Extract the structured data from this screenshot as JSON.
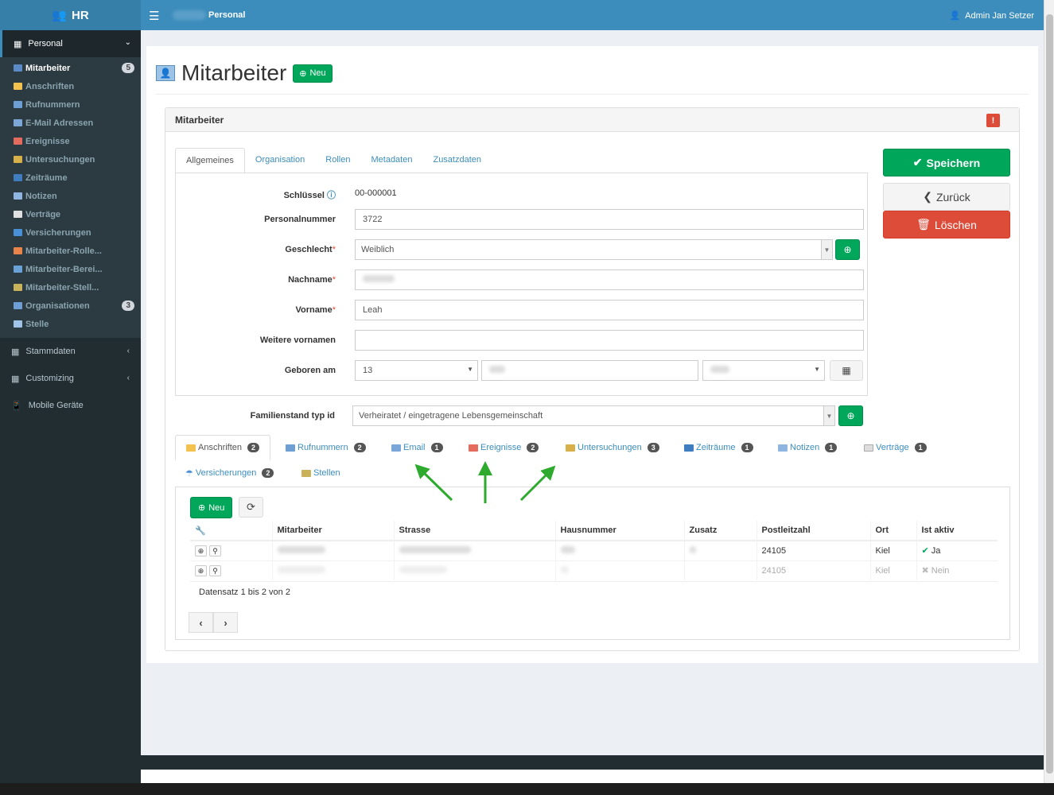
{
  "app": {
    "title": "HR",
    "breadcrumb": "Personal",
    "user": "Admin Jan Setzer"
  },
  "sidebar": {
    "section": "Personal",
    "items": [
      {
        "label": "Mitarbeiter",
        "count": "5",
        "color": "#5b8bc7"
      },
      {
        "label": "Anschriften",
        "color": "#f2c14e"
      },
      {
        "label": "Rufnummern",
        "color": "#6e9fd4"
      },
      {
        "label": "E-Mail Adressen",
        "color": "#7aa6d8"
      },
      {
        "label": "Ereignisse",
        "color": "#e46b5e"
      },
      {
        "label": "Untersuchungen",
        "color": "#d8b04a"
      },
      {
        "label": "Zeiträume",
        "color": "#3f7dc1"
      },
      {
        "label": "Notizen",
        "color": "#8fb6e0"
      },
      {
        "label": "Verträge",
        "color": "#e0e0e0"
      },
      {
        "label": "Versicherungen",
        "color": "#4a90d9"
      },
      {
        "label": "Mitarbeiter-Rolle...",
        "color": "#e8834a"
      },
      {
        "label": "Mitarbeiter-Berei...",
        "color": "#6aa2d8"
      },
      {
        "label": "Mitarbeiter-Stell...",
        "color": "#c9b25a"
      },
      {
        "label": "Organisationen",
        "count": "3",
        "color": "#6e9fd4"
      },
      {
        "label": "Stelle",
        "color": "#9fc4e8"
      }
    ],
    "stammdaten": "Stammdaten",
    "customizing": "Customizing",
    "mobile": "Mobile Geräte"
  },
  "page": {
    "title": "Mitarbeiter",
    "new_button": "Neu"
  },
  "panel": {
    "title": "Mitarbeiter"
  },
  "tabs": [
    "Allgemeines",
    "Organisation",
    "Rollen",
    "Metadaten",
    "Zusatzdaten"
  ],
  "form": {
    "key_label": "Schlüssel",
    "key_value": "00-000001",
    "personalnummer_label": "Personalnummer",
    "personalnummer_value": "3722",
    "geschlecht_label": "Geschlecht",
    "geschlecht_value": "Weiblich",
    "nachname_label": "Nachname",
    "vorname_label": "Vorname",
    "vorname_value": "Leah",
    "weitere_label": "Weitere vornamen",
    "geboren_label": "Geboren am",
    "geboren_day": "13",
    "familienstand_label": "Familienstand typ id",
    "familienstand_value": "Verheiratet / eingetragene Lebensgemeinschaft"
  },
  "actions": {
    "save": "Speichern",
    "back": "Zurück",
    "delete": "Löschen"
  },
  "subtabs": [
    {
      "label": "Anschriften",
      "count": "2"
    },
    {
      "label": "Rufnummern",
      "count": "2"
    },
    {
      "label": "Email",
      "count": "1"
    },
    {
      "label": "Ereignisse",
      "count": "2"
    },
    {
      "label": "Untersuchungen",
      "count": "3"
    },
    {
      "label": "Zeiträume",
      "count": "1"
    },
    {
      "label": "Notizen",
      "count": "1"
    },
    {
      "label": "Verträge",
      "count": "1"
    },
    {
      "label": "Versicherungen",
      "count": "2"
    },
    {
      "label": "Stellen"
    }
  ],
  "subgrid": {
    "new_button": "Neu",
    "columns": [
      "Mitarbeiter",
      "Strasse",
      "Hausnummer",
      "Zusatz",
      "Postleitzahl",
      "Ort",
      "Ist aktiv"
    ],
    "rows": [
      {
        "plz": "24105",
        "ort": "Kiel",
        "aktiv": "Ja"
      },
      {
        "plz": "24105",
        "ort": "Kiel",
        "aktiv": "Nein"
      }
    ],
    "footer": "Datensatz 1 bis 2 von 2"
  },
  "colors": {
    "accent": "#3c8dbc",
    "green": "#00a65a",
    "red": "#dd4b39",
    "arrow": "#2eaa2e"
  }
}
